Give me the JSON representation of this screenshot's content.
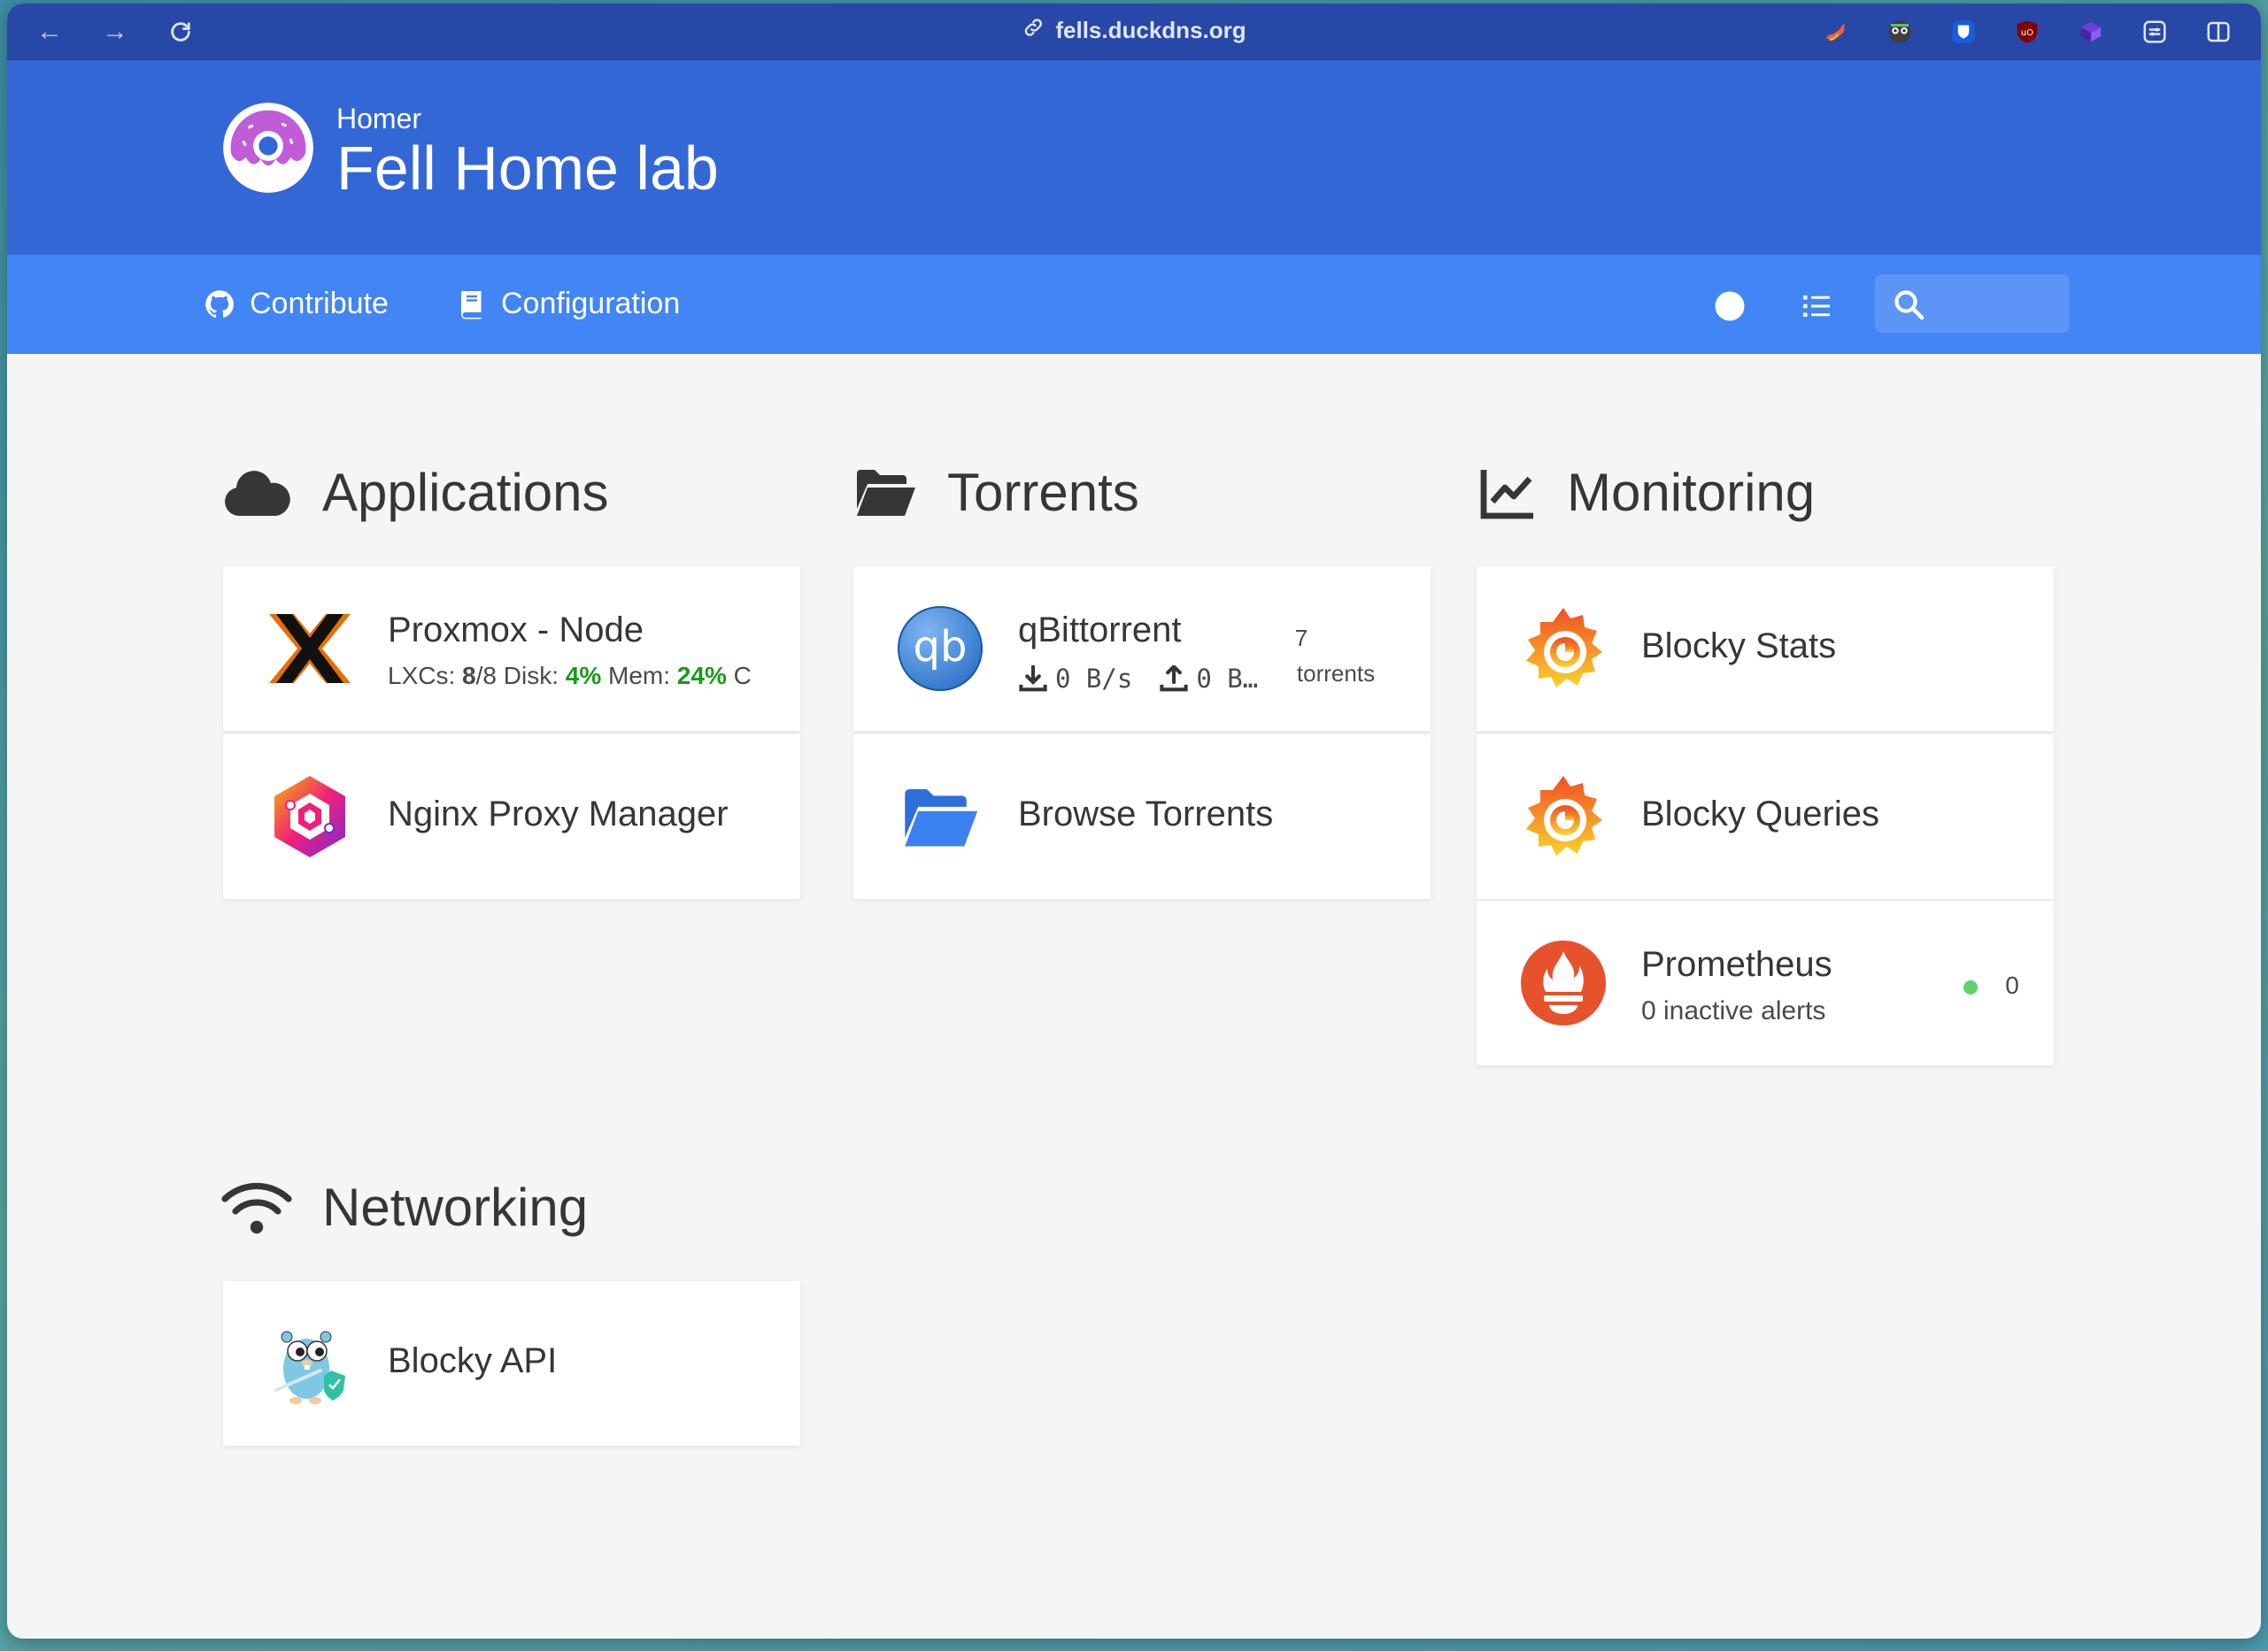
{
  "browser": {
    "url": "fells.duckdns.org"
  },
  "header": {
    "subtitle": "Homer",
    "title": "Fell Home lab"
  },
  "navbar": {
    "links": [
      {
        "label": "Contribute"
      },
      {
        "label": "Configuration"
      }
    ],
    "search": {
      "placeholder": ""
    }
  },
  "groups": {
    "applications": {
      "name": "Applications",
      "items": [
        {
          "name": "Proxmox - Node",
          "stats": {
            "lxcs_label": "LXCs:",
            "lxcs_value": "8",
            "lxcs_total": "/8",
            "disk_label": "Disk:",
            "disk_value": "4%",
            "mem_label": "Mem:",
            "mem_value": "24%",
            "cpu_label": "C"
          }
        },
        {
          "name": "Nginx Proxy Manager"
        }
      ]
    },
    "torrents": {
      "name": "Torrents",
      "items": [
        {
          "name": "qBittorrent",
          "download": "0 B/s",
          "upload": "0 B…",
          "count": "7",
          "count_label": "torrents"
        },
        {
          "name": "Browse Torrents"
        }
      ]
    },
    "monitoring": {
      "name": "Monitoring",
      "items": [
        {
          "name": "Blocky Stats"
        },
        {
          "name": "Blocky Queries"
        },
        {
          "name": "Prometheus",
          "subtitle": "0 inactive alerts",
          "alert_count": "0"
        }
      ]
    },
    "networking": {
      "name": "Networking",
      "items": [
        {
          "name": "Blocky API"
        }
      ]
    }
  }
}
